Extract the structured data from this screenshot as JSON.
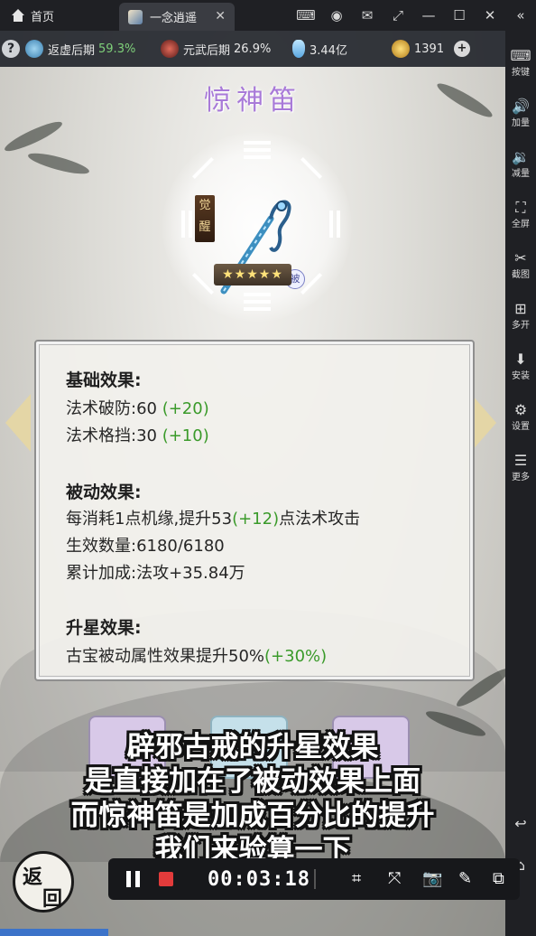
{
  "titlebar": {
    "home_label": "首页",
    "tab_label": "一念逍遥",
    "tab_close": "✕",
    "controls": [
      "⌨",
      "◉",
      "✉",
      "⤢",
      "—",
      "☐",
      "✕",
      "«"
    ]
  },
  "currency": {
    "help": "?",
    "realm1_name": "返虚后期",
    "realm1_pct": "59.3%",
    "realm2_name": "元武后期",
    "realm2_pct": "26.9%",
    "spirit_stones": "3.44亿",
    "gold": "1391",
    "plus": "+"
  },
  "item": {
    "name": "惊神笛",
    "awaken_badge": "觉醒",
    "passive_badge": "被",
    "stars": "★★★★★"
  },
  "details": {
    "base_title": "基础效果:",
    "base_1_label": "法术破防:60 ",
    "base_1_bonus": "(+20)",
    "base_2_label": "法术格挡:30 ",
    "base_2_bonus": "(+10)",
    "passive_title": "被动效果:",
    "passive_1_pre": "每消耗1点机缘,提升53",
    "passive_1_bonus": "(+12)",
    "passive_1_post": "点法术攻击",
    "passive_2": "生效数量:6180/6180",
    "passive_3": "累计加成:法攻+35.84万",
    "star_title": "升星效果:",
    "star_1_pre": "古宝被动属性效果提升50%",
    "star_1_bonus": "(+30%)"
  },
  "subtitle": {
    "line1": "辟邪古戒的升星效果",
    "line2": "是直接加在了被动效果上面",
    "line3": "而惊神笛是加成百分比的提升",
    "line4": "我们来验算一下"
  },
  "back_button": {
    "char1": "返",
    "char2": "回"
  },
  "recorder": {
    "time": "00:03:18",
    "tools": [
      "⌗",
      "⤧",
      "📷",
      "✎",
      "⧉"
    ]
  },
  "sidebar": [
    {
      "icon": "⌨",
      "label": "按键"
    },
    {
      "icon": "🔊",
      "label": "加量"
    },
    {
      "icon": "🔉",
      "label": "减量"
    },
    {
      "icon": "⛶",
      "label": "全屏"
    },
    {
      "icon": "✂",
      "label": "截图"
    },
    {
      "icon": "⊞",
      "label": "多开"
    },
    {
      "icon": "⬇",
      "label": "安装"
    },
    {
      "icon": "⚙",
      "label": "设置"
    },
    {
      "icon": "☰",
      "label": "更多"
    },
    {
      "icon": "↩",
      "label": ""
    },
    {
      "icon": "⌂",
      "label": ""
    }
  ],
  "colors": {
    "bonus_green": "#3a9a2a",
    "title_purple": "#a87ad8",
    "accent_gold": "#e4d6a6"
  }
}
